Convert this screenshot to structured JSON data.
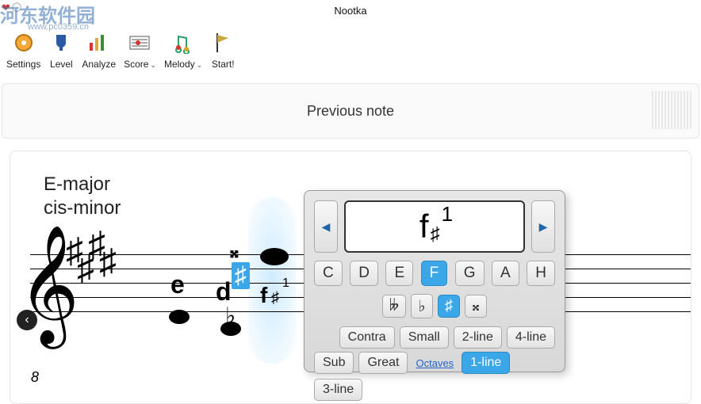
{
  "app_title": "Nootka",
  "watermark": {
    "main": "河东软件园",
    "sub": "www.pc0359.cn"
  },
  "toolbar": {
    "settings": "Settings",
    "level": "Level",
    "analyze": "Analyze",
    "score": "Score",
    "melody": "Melody",
    "start": "Start!"
  },
  "note_bar": "Previous note",
  "key": {
    "major": "E-major",
    "minor": "cis-minor"
  },
  "clef_octave": "8",
  "staff_notes": {
    "e_label": "e",
    "d_label": "d",
    "d_flat": "♭",
    "f_label": "f",
    "f_sharp": "♯",
    "f_sup": "1",
    "f_dblsharp": "𝄪"
  },
  "panel": {
    "display": {
      "base": "f",
      "acc": "♯",
      "sup": "1"
    },
    "nav_prev": "◀",
    "nav_next": "▶",
    "letters": {
      "c": "C",
      "d": "D",
      "e": "E",
      "f": "F",
      "g": "G",
      "a": "A",
      "h": "H"
    },
    "acc": {
      "dblflat": "𝄫",
      "flat": "♭",
      "sharp": "♯",
      "dblsharp": "𝄪"
    },
    "oct": {
      "contra": "Contra",
      "small": "Small",
      "line2": "2-line",
      "line4": "4-line",
      "sub": "Sub",
      "great": "Great",
      "line1": "1-line",
      "line3": "3-line"
    },
    "octaves_link": "Octaves"
  }
}
